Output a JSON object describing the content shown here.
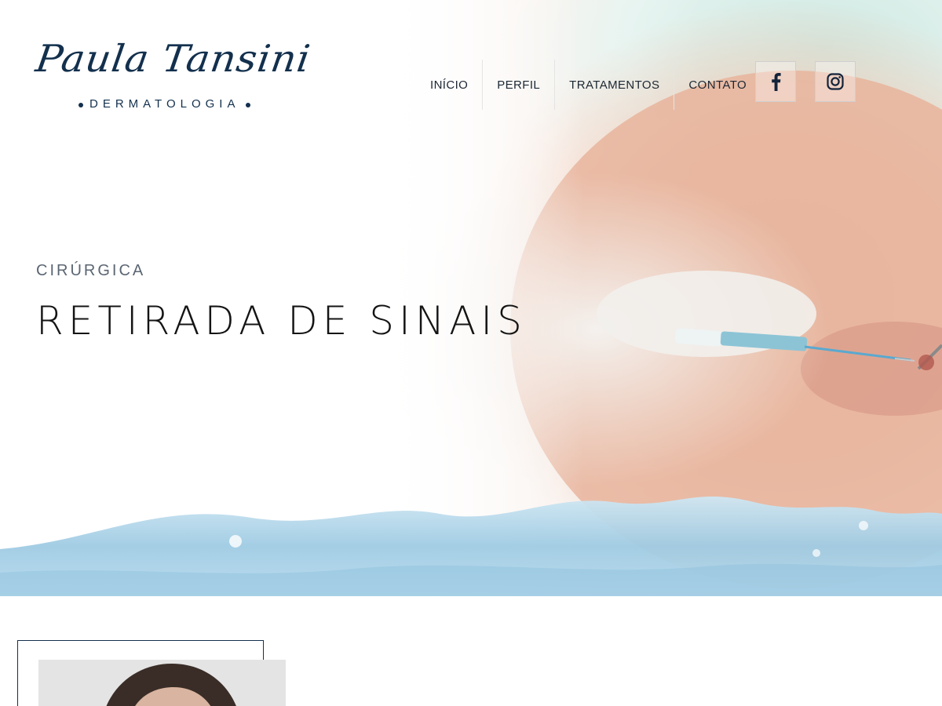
{
  "logo": {
    "script": "Paula Tansini",
    "subtitle": "DERMATOLOGIA"
  },
  "nav": {
    "items": [
      {
        "label": "INÍCIO"
      },
      {
        "label": "PERFIL"
      },
      {
        "label": "TRATAMENTOS"
      },
      {
        "label": "CONTATO"
      }
    ]
  },
  "social": {
    "facebook_icon": "facebook-icon",
    "instagram_icon": "instagram-icon"
  },
  "hero": {
    "kicker": "CIRÚRGICA",
    "title": "RETIRADA DE SINAIS"
  },
  "colors": {
    "brand_navy": "#13304d",
    "watercolor_blue": "#a9d3ea",
    "skin": "#e9b9a1"
  }
}
